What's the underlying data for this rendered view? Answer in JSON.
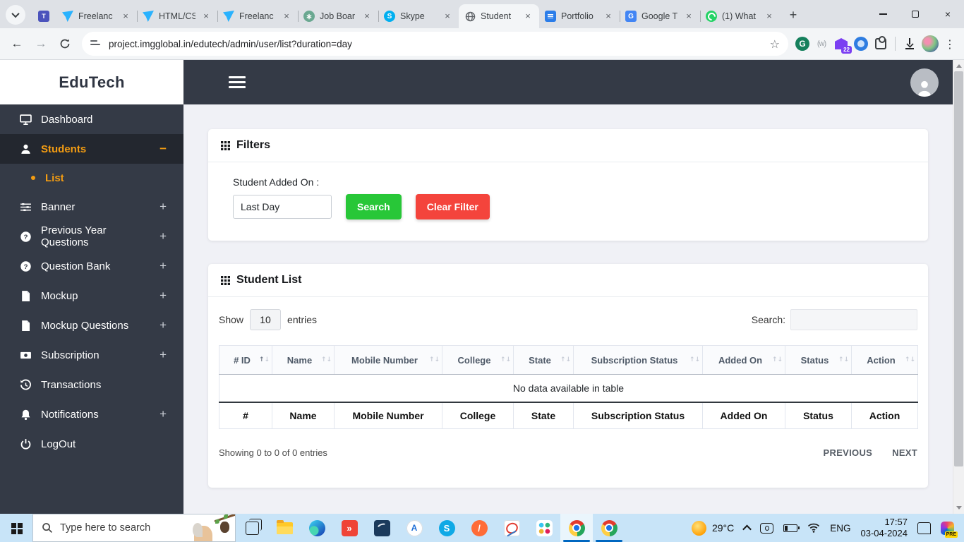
{
  "icons": {
    "close": "×",
    "plus": "+",
    "star": "☆",
    "kebab": "⋮",
    "back": "←",
    "forward": "→",
    "sort_asc": "↑",
    "sort_desc": "↓",
    "teams_glyph": "T",
    "chatgpt_glyph": "∗",
    "skype_glyph": "S",
    "translate_glyph": "G",
    "anydesk_glyph": "»",
    "postman_glyph": "/",
    "modeling_glyph": "A"
  },
  "theme": {
    "accent_orange": "#f39c12",
    "sidebar_dark": "#343a46",
    "success_green": "#28c738",
    "danger_red": "#f4443c",
    "taskbar_blue": "#c8e4f8",
    "running_underline_blue": "#0067c0"
  },
  "browser": {
    "tabs": [
      {
        "title": "Freelanc"
      },
      {
        "title": "HTML/CS"
      },
      {
        "title": "Freelanc"
      },
      {
        "title": "Job Boar"
      },
      {
        "title": "Skype"
      },
      {
        "title": "Student"
      },
      {
        "title": "Portfolio"
      },
      {
        "title": "Google T"
      },
      {
        "title": "(1) What"
      }
    ],
    "url": "project.imgglobal.in/edutech/admin/user/list?duration=day",
    "extension_badge": "22"
  },
  "app": {
    "brand": "EduTech",
    "sidebar": [
      {
        "label": "Dashboard"
      },
      {
        "label": "Students",
        "suffix": "−"
      },
      {
        "label": "List"
      },
      {
        "label": "Banner",
        "suffix": "+"
      },
      {
        "label": "Previous Year Questions",
        "suffix": "+"
      },
      {
        "label": "Question Bank",
        "suffix": "+"
      },
      {
        "label": "Mockup",
        "suffix": "+"
      },
      {
        "label": "Mockup Questions",
        "suffix": "+"
      },
      {
        "label": "Subscription",
        "suffix": "+"
      },
      {
        "label": "Transactions"
      },
      {
        "label": "Notifications",
        "suffix": "+"
      },
      {
        "label": "LogOut"
      }
    ],
    "filters": {
      "title": "Filters",
      "field_label": "Student Added On :",
      "field_value": "Last Day",
      "search_button": "Search",
      "clear_button": "Clear Filter"
    },
    "list": {
      "title": "Student List",
      "show_label": "Show",
      "page_length": "10",
      "entries_label": "entries",
      "search_label": "Search:",
      "columns": [
        "# ID",
        "Name",
        "Mobile Number",
        "College",
        "State",
        "Subscription Status",
        "Added On",
        "Status",
        "Action"
      ],
      "footer_columns": [
        "#",
        "Name",
        "Mobile Number",
        "College",
        "State",
        "Subscription Status",
        "Added On",
        "Status",
        "Action"
      ],
      "empty_text": "No data available in table",
      "info": "Showing 0 to 0 of 0 entries",
      "previous": "PREVIOUS",
      "next": "NEXT"
    }
  },
  "taskbar": {
    "search_placeholder": "Type here to search",
    "temperature": "29°C",
    "language": "ENG",
    "time": "17:57",
    "date": "03-04-2024",
    "copilot_badge": "PRE"
  }
}
